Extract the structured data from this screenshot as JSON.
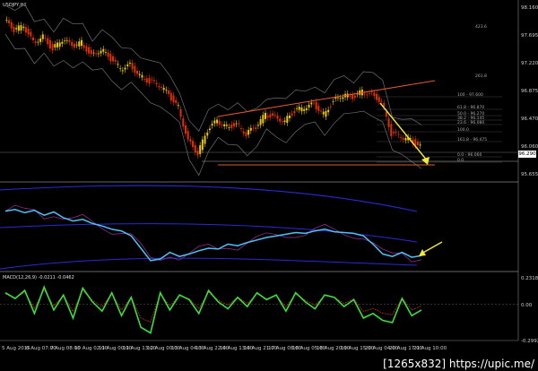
{
  "chart_data": [
    {
      "type": "candlestick",
      "panel": "price",
      "symbol_label": "USDJPY,H1",
      "y_ticks": [
        "98.160",
        "97.695",
        "97.220",
        "96.875",
        "96.470",
        "96.060",
        "95.655"
      ],
      "current_price": "96.290",
      "bollinger": "on",
      "fib_levels": [
        "423.6",
        "261.8",
        "100 - 97.600",
        "61.8 - 96.870",
        "50.0 - 96.270",
        "38.2 - 96.145",
        "23.6 - 96.080",
        "100.0",
        "161.8 - 96.475",
        "0.0 - 96.060",
        "0.0"
      ],
      "close_path": [
        98.05,
        97.9,
        97.95,
        97.7,
        97.8,
        97.6,
        97.75,
        97.65,
        97.7,
        97.5,
        97.6,
        97.45,
        97.3,
        97.35,
        97.2,
        97.1,
        97.05,
        96.9,
        96.7,
        96.2,
        96.0,
        96.35,
        96.5,
        96.4,
        96.45,
        96.3,
        96.4,
        96.6,
        96.55,
        96.5,
        96.65,
        96.7,
        96.75,
        96.6,
        96.8,
        96.9,
        96.85,
        96.95,
        96.9,
        96.8,
        96.3,
        96.25,
        96.2,
        96.1
      ]
    },
    {
      "type": "line",
      "panel": "oscillator",
      "series": [
        {
          "name": "",
          "values": [
            70,
            72,
            68,
            71,
            65,
            69,
            62,
            58,
            60,
            55,
            52,
            48,
            46,
            40,
            25,
            10,
            12,
            20,
            15,
            18,
            22,
            25,
            24,
            30,
            28,
            32,
            35,
            38,
            40,
            42,
            44,
            43,
            46,
            48,
            45,
            44,
            43,
            40,
            30,
            18,
            15,
            20,
            14,
            16
          ]
        }
      ]
    },
    {
      "type": "line",
      "panel": "macd",
      "label": "MACD(12,26,9) -0.0211 -0.0462",
      "y_ticks": [
        "0.2318",
        "0.00",
        "-0.2992"
      ],
      "series": [
        {
          "name": "",
          "values": [
            0.1,
            0.05,
            0.12,
            -0.08,
            0.15,
            -0.05,
            0.08,
            -0.12,
            0.14,
            0.02,
            -0.06,
            0.1,
            -0.1,
            0.06,
            -0.2,
            -0.25,
            0.1,
            -0.05,
            0.08,
            0.04,
            -0.08,
            0.12,
            0.02,
            -0.04,
            0.06,
            -0.02,
            0.1,
            0.04,
            0.08,
            -0.06,
            0.1,
            0.02,
            -0.04,
            0.08,
            0.06,
            -0.02,
            0.04,
            -0.12,
            -0.08,
            -0.14,
            -0.16,
            0.05,
            -0.1,
            -0.05
          ]
        }
      ]
    }
  ],
  "x_labels": [
    "5 Aug 2015",
    "6 Aug 07:00",
    "7 Aug 08:00",
    "10 Aug 02:00",
    "11 Aug 00:00",
    "11 Aug 13:00",
    "12 Aug 00:00",
    "13 Aug 04:00",
    "13 Aug 22:00",
    "14 Aug 13:00",
    "14 Aug 21:00",
    "17 Aug 08:00",
    "18 Aug 05:00",
    "18 Aug 20:00",
    "19 Aug 15:00",
    "20 Aug 04:00",
    "20 Aug 17:00",
    "21 Aug 10:00"
  ],
  "colors": {
    "bull": "#e8c600",
    "bear": "#e03000",
    "band": "#6f6f6f",
    "osc": "#4fc3f7",
    "envelope": "#2a2ad8",
    "macd": "#3adf3a",
    "arrow": "#f2ea3a",
    "trend": "#e05a30"
  },
  "watermark": "[1265x832] https://upic.me/"
}
